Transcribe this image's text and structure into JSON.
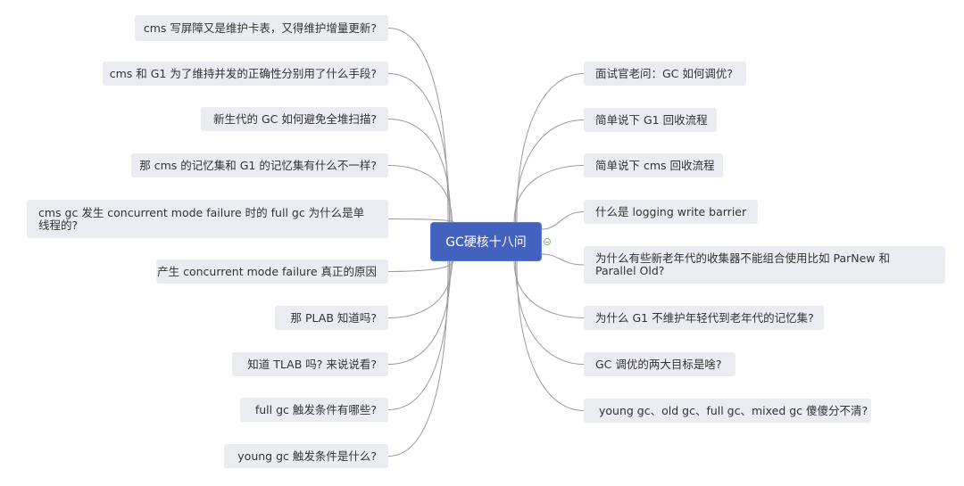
{
  "mindmap": {
    "root": {
      "label": "GC硬核十八问"
    },
    "left_topics": [
      {
        "label": "cms 写屏障又是维护卡表，又得维护增量更新?"
      },
      {
        "label": "cms 和 G1 为了维持并发的正确性分别用了什么手段?"
      },
      {
        "label": "新生代的 GC 如何避免全堆扫描?"
      },
      {
        "label": "那 cms 的记忆集和 G1 的记忆集有什么不一样?"
      },
      {
        "label": "cms gc 发生 concurrent mode failure 时的 full gc 为什么是单线程的?"
      },
      {
        "label": "产生 concurrent mode failure 真正的原因"
      },
      {
        "label": "那 PLAB 知道吗?"
      },
      {
        "label": "知道 TLAB 吗? 来说说看?"
      },
      {
        "label": "full gc 触发条件有哪些?"
      },
      {
        "label": "young gc 触发条件是什么?"
      }
    ],
    "right_topics": [
      {
        "label": "面试官老问：GC 如何调优?"
      },
      {
        "label": "简单说下 G1 回收流程"
      },
      {
        "label": "简单说下 cms 回收流程"
      },
      {
        "label": "什么是 logging write barrier"
      },
      {
        "label": "为什么有些新老年代的收集器不能组合使用比如 ParNew 和 Parallel Old?"
      },
      {
        "label": "为什么 G1 不维护年轻代到老年代的记忆集?"
      },
      {
        "label": "GC 调优的两大目标是啥?"
      },
      {
        "label": "young gc、old gc、full gc、mixed gc 傻傻分不清?"
      }
    ],
    "collapse_icon": "minus-circle-icon",
    "colors": {
      "root_fill": "#4361be",
      "topic_fill": "#ebecf2",
      "link": "#9a9a9a",
      "collapse": "#7cc35a"
    }
  }
}
